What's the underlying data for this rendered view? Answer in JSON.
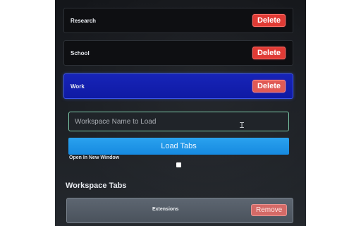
{
  "workspaces": [
    {
      "name": "Research",
      "delete_label": "Delete"
    },
    {
      "name": "School",
      "delete_label": "Delete"
    },
    {
      "name": "Work",
      "delete_label": "Delete"
    }
  ],
  "load": {
    "placeholder": "Workspace Name to Load",
    "button_label": "Load Tabs",
    "open_new_window_label": "Open In New Window"
  },
  "tabs_section": {
    "heading": "Workspace Tabs",
    "items": [
      {
        "label": "Extensions",
        "remove_label": "Remove"
      }
    ]
  },
  "colors": {
    "accent_blue": "#168ae0",
    "active_workspace": "#0f1aa4",
    "delete_red": "#e03b35",
    "input_focus": "#7cc9a8"
  }
}
